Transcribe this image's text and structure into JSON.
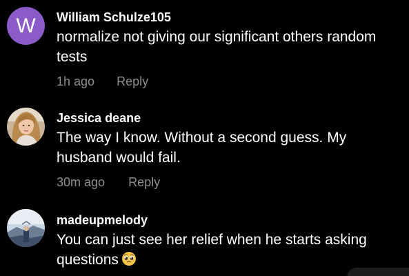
{
  "comments": [
    {
      "avatar_letter": "W",
      "avatar_color": "#8b5cc7",
      "username": "William Schulze105",
      "text": "normalize not giving our significant others random tests",
      "time": "1h ago",
      "reply": "Reply"
    },
    {
      "avatar_icon": "profile-photo-woman-blonde",
      "username": "Jessica deane",
      "text": "The way I know. Without a second guess. My husband would fail.",
      "time": "30m ago",
      "reply": "Reply"
    },
    {
      "avatar_icon": "profile-photo-sky-landscape",
      "username": "madeupmelody",
      "text": "You can just see her relief when he starts asking questions",
      "emoji": "pleading-face-emoji"
    }
  ]
}
